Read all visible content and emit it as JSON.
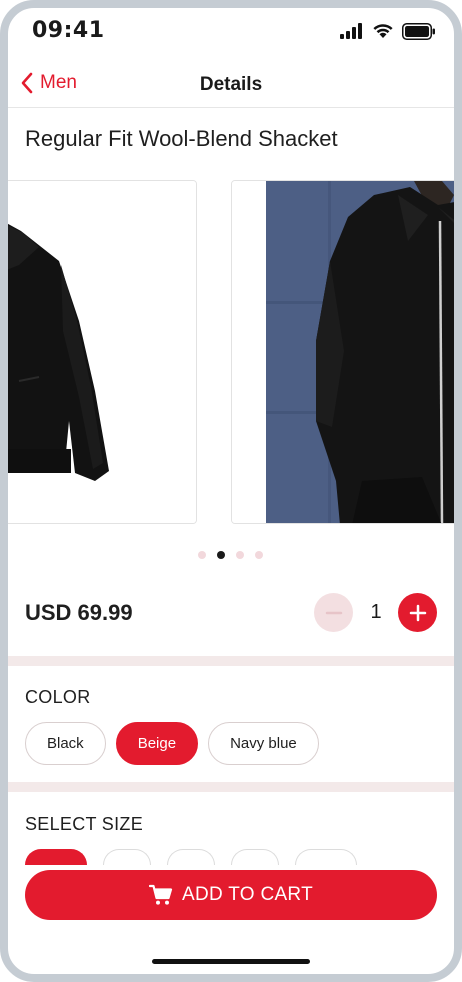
{
  "status_bar": {
    "time": "09:41"
  },
  "nav": {
    "back_label": "Men",
    "title": "Details"
  },
  "product": {
    "title": "Regular Fit Wool-Blend Shacket",
    "price": "USD 69.99"
  },
  "carousel": {
    "slide_count": 4,
    "active_index": 1
  },
  "quantity": {
    "value": "1"
  },
  "colors": {
    "label": "COLOR",
    "options": [
      "Black",
      "Beige",
      "Navy blue"
    ],
    "selected": "Beige"
  },
  "sizes": {
    "label": "SELECT SIZE"
  },
  "cart": {
    "button_label": "ADD TO CART"
  },
  "theme": {
    "accent": "#e31b2e",
    "accent_soft": "#f3dfe1",
    "divider": "#f3e9e9"
  }
}
